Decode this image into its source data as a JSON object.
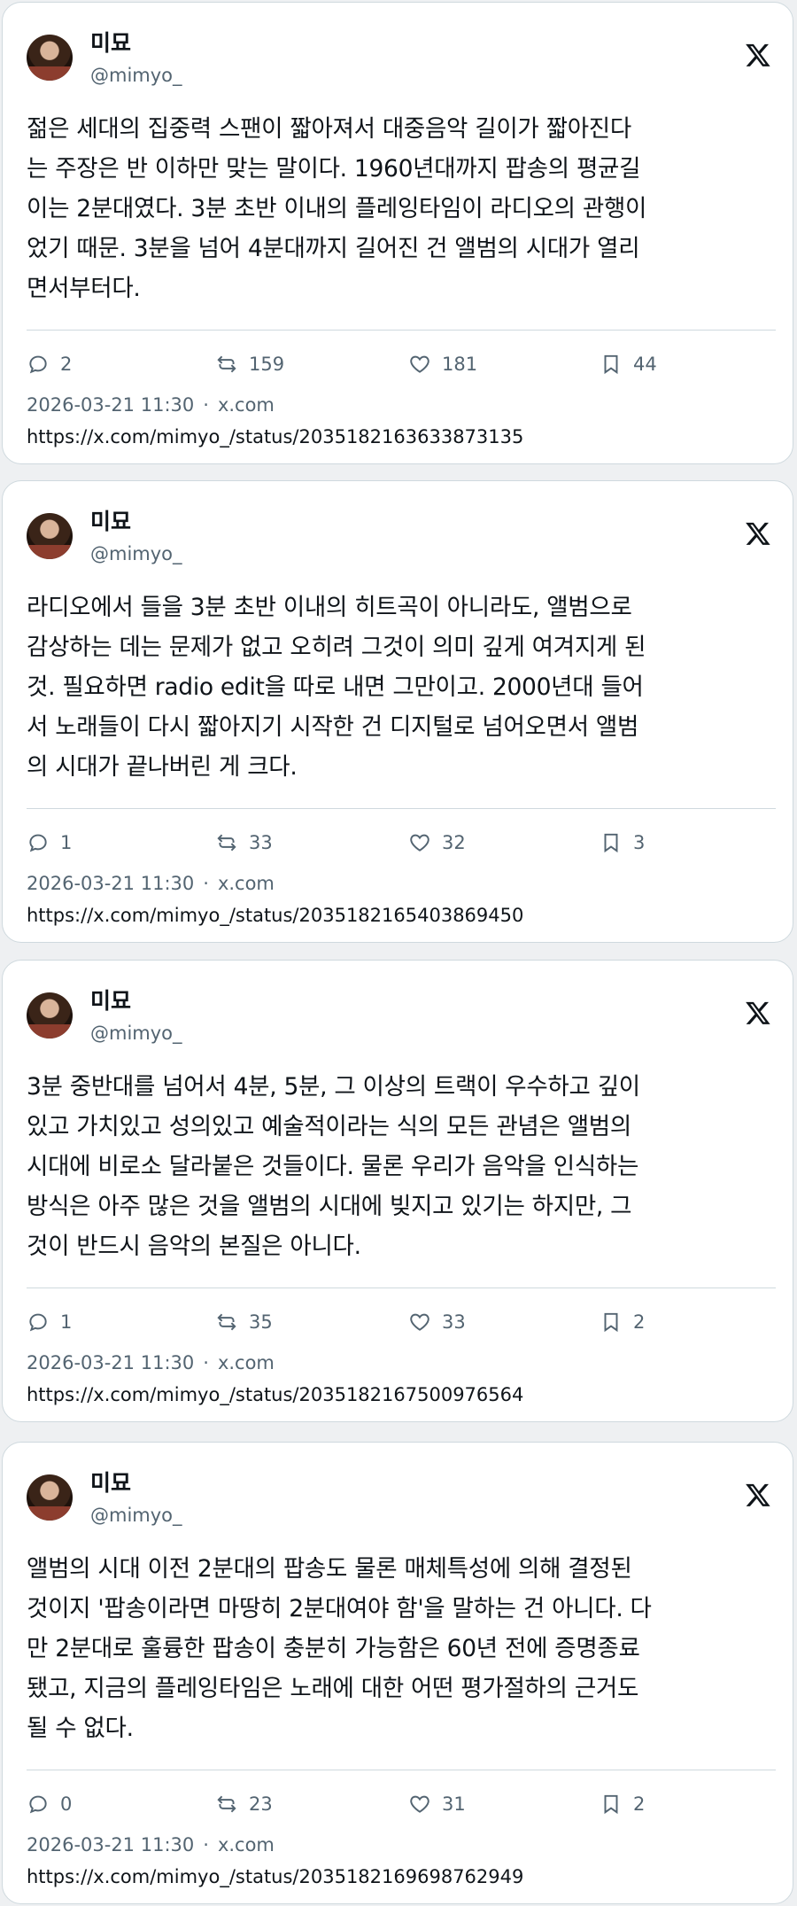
{
  "tweets": [
    {
      "name": "미묘",
      "handle": "@mimyo_",
      "text": "젊은 세대의 집중력 스팬이 짧아져서 대중음악 길이가 짧아진다\n는 주장은 반 이하만 맞는 말이다. 1960년대까지 팝송의 평균길\n이는 2분대였다. 3분 초반 이내의 플레잉타임이 라디오의 관행이\n었기 때문. 3분을 넘어 4분대까지 길어진 건 앨범의 시대가 열리\n면서부터다.",
      "replies": "2",
      "reposts": "159",
      "likes": "181",
      "bookmarks": "44",
      "datetime": "2026-03-21 11:30",
      "source": "x.com",
      "url": "https://x.com/mimyo_/status/2035182163633873135"
    },
    {
      "name": "미묘",
      "handle": "@mimyo_",
      "text": "라디오에서 들을 3분 초반 이내의 히트곡이 아니라도, 앨범으로\n감상하는 데는 문제가 없고 오히려 그것이 의미 깊게 여겨지게 된\n것. 필요하면 radio edit을 따로 내면 그만이고. 2000년대 들어\n서 노래들이 다시 짧아지기 시작한 건 디지털로 넘어오면서 앨범\n의 시대가 끝나버린 게 크다.",
      "replies": "1",
      "reposts": "33",
      "likes": "32",
      "bookmarks": "3",
      "datetime": "2026-03-21 11:30",
      "source": "x.com",
      "url": "https://x.com/mimyo_/status/2035182165403869450"
    },
    {
      "name": "미묘",
      "handle": "@mimyo_",
      "text": "3분 중반대를 넘어서 4분, 5분, 그 이상의 트랙이 우수하고 깊이\n있고 가치있고 성의있고 예술적이라는 식의 모든 관념은 앨범의\n시대에 비로소 달라붙은 것들이다. 물론 우리가 음악을 인식하는\n방식은 아주 많은 것을 앨범의 시대에 빚지고 있기는 하지만, 그\n것이 반드시 음악의 본질은 아니다.",
      "replies": "1",
      "reposts": "35",
      "likes": "33",
      "bookmarks": "2",
      "datetime": "2026-03-21 11:30",
      "source": "x.com",
      "url": "https://x.com/mimyo_/status/2035182167500976564"
    },
    {
      "name": "미묘",
      "handle": "@mimyo_",
      "text": "앨범의 시대 이전 2분대의 팝송도 물론 매체특성에 의해 결정된\n것이지 '팝송이라면 마땅히 2분대여야 함'을 말하는 건 아니다. 다\n만 2분대로 훌륭한 팝송이 충분히 가능함은 60년 전에 증명종료\n됐고, 지금의 플레잉타임은 노래에 대한 어떤 평가절하의 근거도\n될 수 없다.",
      "replies": "0",
      "reposts": "23",
      "likes": "31",
      "bookmarks": "2",
      "datetime": "2026-03-21 11:30",
      "source": "x.com",
      "url": "https://x.com/mimyo_/status/2035182169698762949"
    }
  ]
}
